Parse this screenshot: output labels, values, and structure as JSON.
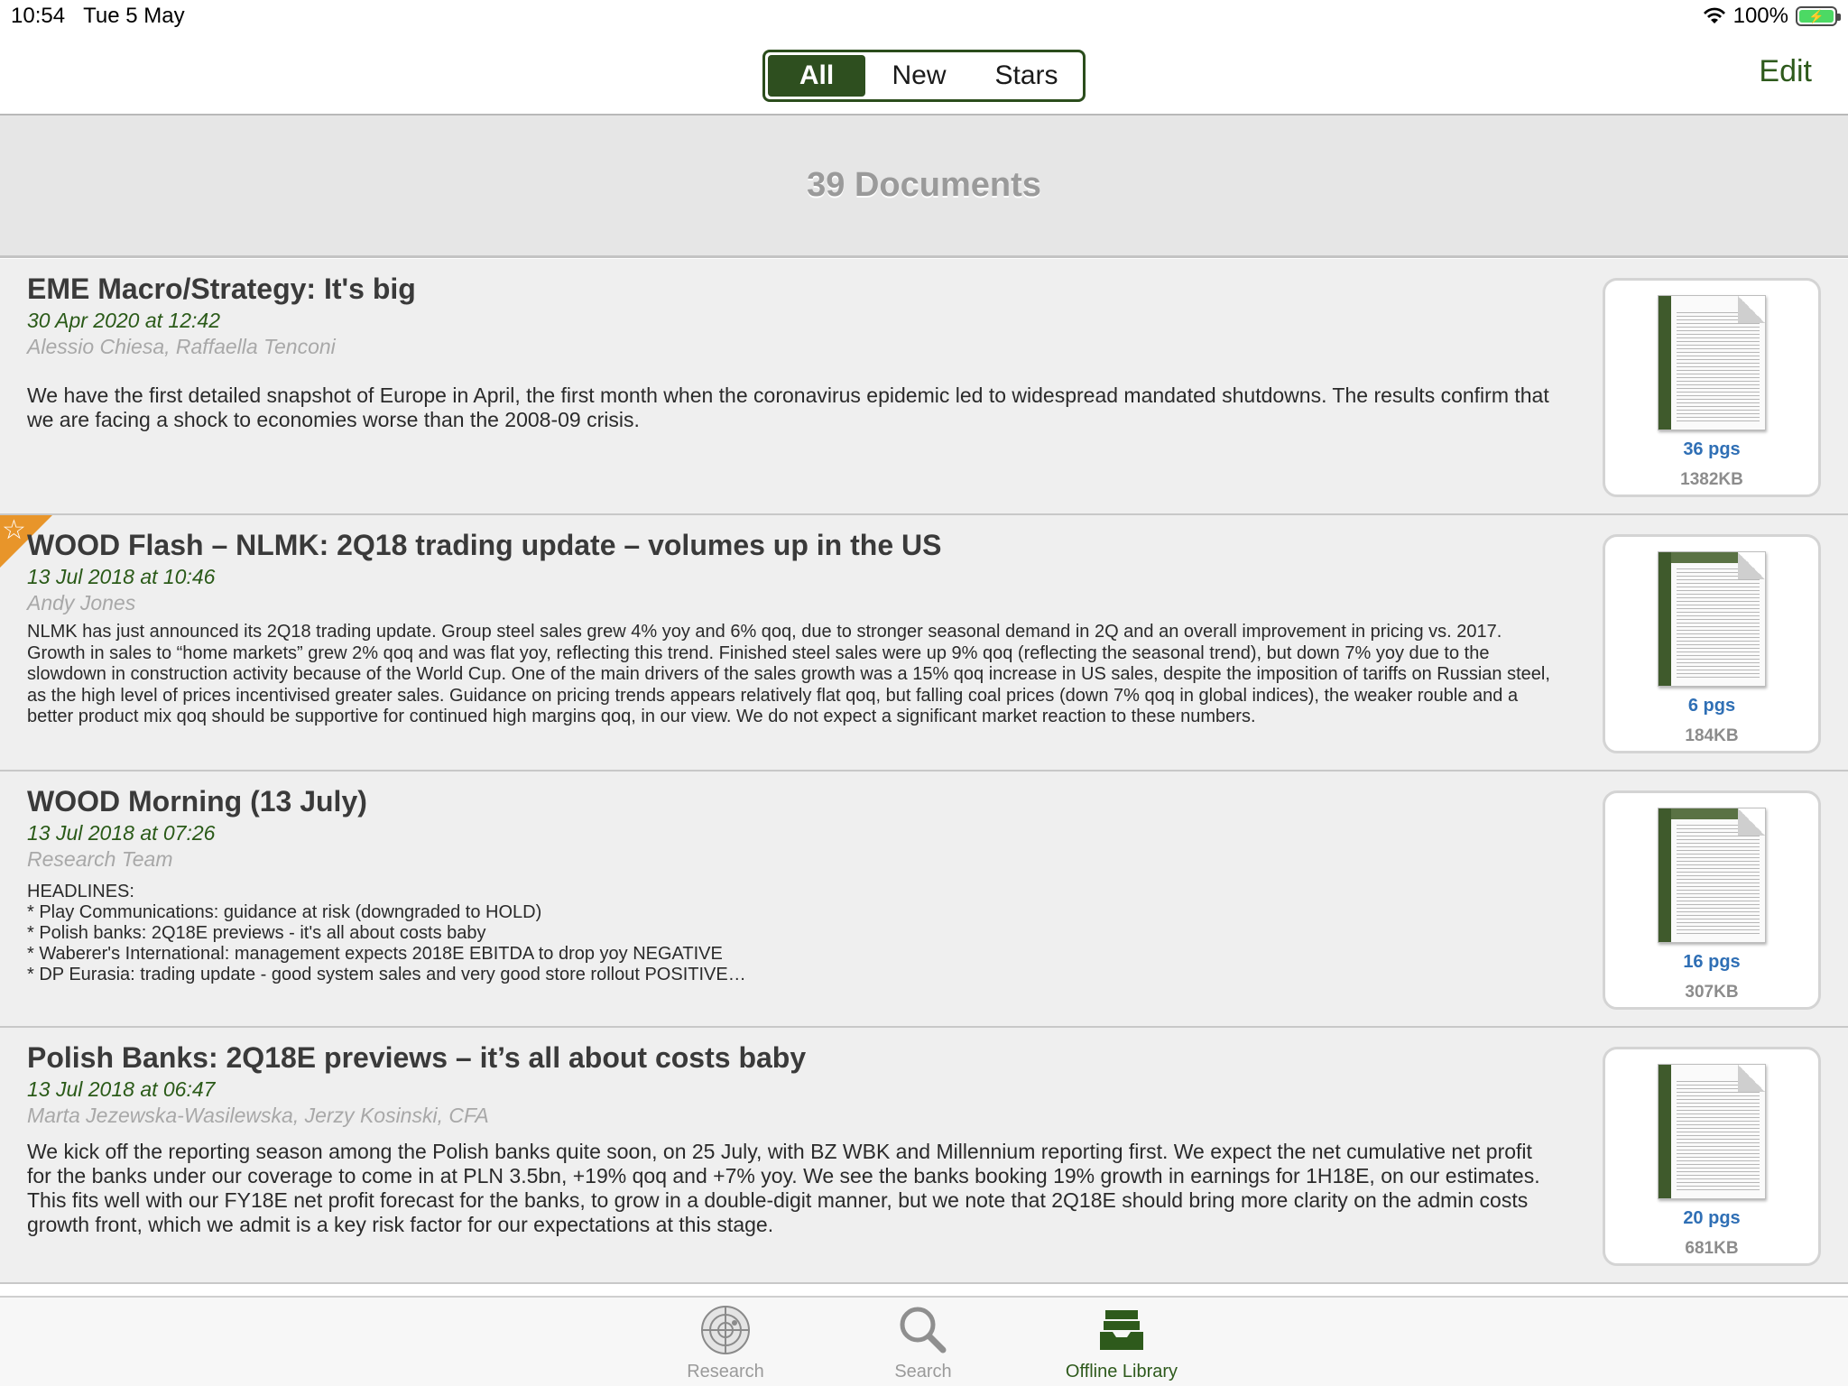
{
  "status_bar": {
    "time": "10:54",
    "date": "Tue 5 May",
    "battery": "100%"
  },
  "nav": {
    "segments": [
      "All",
      "New",
      "Stars"
    ],
    "selected_segment": "All",
    "edit_label": "Edit"
  },
  "header": {
    "count_label": "39 Documents"
  },
  "documents": [
    {
      "title": "EME Macro/Strategy: It's big",
      "date": "30 Apr 2020 at 12:42",
      "authors": "Alessio Chiesa, Raffaella Tenconi",
      "summary": "We have the first detailed snapshot of Europe in April, the first month when the coronavirus epidemic led to widespread mandated shutdowns. The results confirm that we are facing a shock to economies worse than the 2008-09 crisis.",
      "pages": "36 pgs",
      "size": "1382KB",
      "starred": false
    },
    {
      "title": "WOOD Flash – NLMK: 2Q18 trading update – volumes up in the US",
      "date": "13 Jul 2018 at 10:46",
      "authors": "Andy Jones",
      "summary": "NLMK has just announced its 2Q18 trading update. Group steel sales grew 4% yoy and 6% qoq, due to stronger seasonal demand in 2Q and an overall improvement in pricing vs. 2017. Growth in sales to “home markets” grew 2% qoq and was flat yoy, reflecting this trend. Finished steel sales were up 9% qoq (reflecting the seasonal trend), but down 7% yoy due to the slowdown in construction activity because of the World Cup. One of the main drivers of the sales growth was a 15% qoq increase in US sales, despite the imposition of tariffs on Russian steel, as the high level of prices incentivised greater sales. Guidance on pricing trends appears relatively flat qoq, but falling coal prices (down 7% qoq in global indices), the weaker rouble and a better product mix qoq should be supportive for continued high margins qoq, in our view. We do not expect a significant market reaction to these numbers.",
      "pages": "6 pgs",
      "size": "184KB",
      "starred": true
    },
    {
      "title": "WOOD Morning (13 July)",
      "date": "13 Jul 2018 at 07:26",
      "authors": "Research Team",
      "summary": "HEADLINES:\n   * Play Communications: guidance at risk (downgraded to HOLD)\n   * Polish banks: 2Q18E previews - it's all about costs baby\n   * Waberer's International: management expects 2018E EBITDA to drop yoy NEGATIVE\n   * DP Eurasia: trading update - good system sales and very good store rollout POSITIVE…",
      "pages": "16 pgs",
      "size": "307KB",
      "starred": false
    },
    {
      "title": "Polish Banks: 2Q18E previews – it’s all about costs baby",
      "date": "13 Jul 2018 at 06:47",
      "authors": "Marta Jezewska-Wasilewska, Jerzy Kosinski, CFA",
      "summary": "We kick off the reporting season among the Polish banks quite soon, on 25 July, with BZ WBK and Millennium reporting first. We expect the net cumulative net profit for the banks under our coverage to come in at PLN 3.5bn, +19% qoq and +7% yoy. We see the banks booking 19% growth in earnings for 1H18E, on our estimates. This fits well with our FY18E net profit forecast for the banks, to grow in a double-digit manner, but we note that 2Q18E should bring more clarity on the admin costs growth front, which we admit is a key risk factor for our expectations at this stage.",
      "pages": "20 pgs",
      "size": "681KB",
      "starred": false
    }
  ],
  "tabs": [
    {
      "label": "Research",
      "icon": "radar-icon",
      "active": false
    },
    {
      "label": "Search",
      "icon": "magnifier-icon",
      "active": false
    },
    {
      "label": "Offline Library",
      "icon": "inbox-tray-icon",
      "active": true
    }
  ],
  "colors": {
    "accent": "#2e5a1c",
    "date": "#2a5a18",
    "pages": "#2f6fb5",
    "star": "#e8952a"
  }
}
